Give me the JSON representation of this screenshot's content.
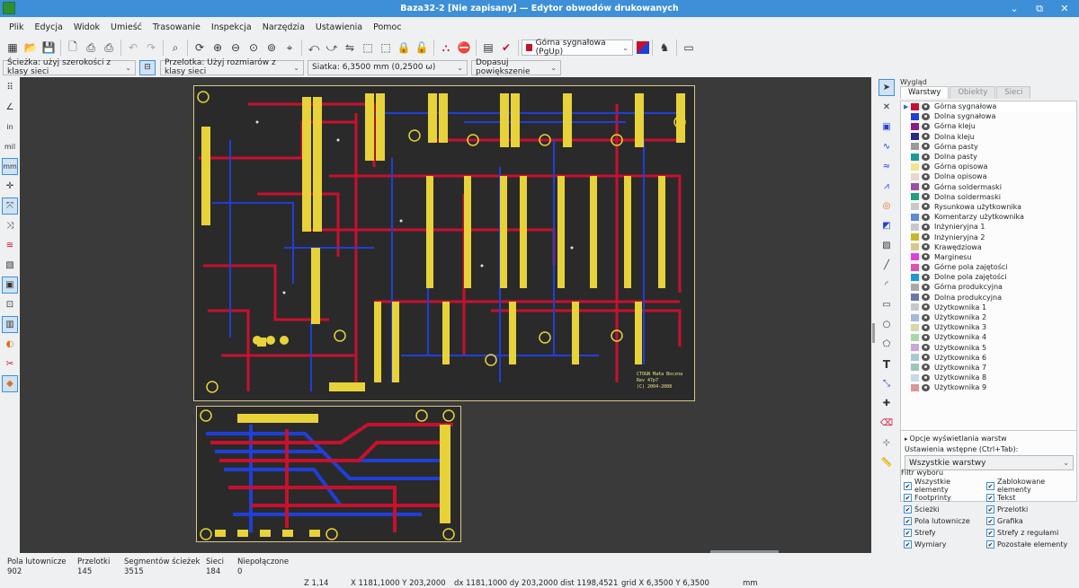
{
  "window": {
    "title": "Baza32-2 [Nie zapisany] — Edytor obwodów drukowanych",
    "controls": [
      "⌄",
      "⧉",
      "✕"
    ]
  },
  "menu": [
    "Plik",
    "Edycja",
    "Widok",
    "Umieść",
    "Trasowanie",
    "Inspekcja",
    "Narzędzia",
    "Ustawienia",
    "Pomoc"
  ],
  "toolbar": {
    "active_layer": "Górna sygnałowa (PgUp)",
    "active_layer_color": "#c8102e"
  },
  "options": {
    "track": "Ścieżka: użyj szerokości z klasy sieci",
    "via": "Przelotka: Użyj rozmiarów z klasy sieci",
    "grid": "Siatka: 6,3500 mm (0,2500 ω)",
    "zoom": "Dopasuj powiększenie"
  },
  "canvas": {
    "footer_text_1": "CTOGN Mała Boczna",
    "footer_text_2": "Rev 47p7",
    "footer_text_3": "(C) 2004-2008",
    "board_bg": "#2a2a2a",
    "top_copper": "#c8102e",
    "bottom_copper": "#1f3fd8",
    "pad_color": "#e8d23a"
  },
  "panel": {
    "title": "Wygląd",
    "tabs": [
      "Warstwy",
      "Obiekty",
      "Sieci"
    ],
    "layers": [
      {
        "name": "Górna sygnałowa",
        "color": "#c8102e"
      },
      {
        "name": "Dolna sygnałowa",
        "color": "#1f3fd8"
      },
      {
        "name": "Górna kleju",
        "color": "#8a1a8a"
      },
      {
        "name": "Dolna kleju",
        "color": "#2a2a8a"
      },
      {
        "name": "Górna pasty",
        "color": "#9a9a9a"
      },
      {
        "name": "Dolna pasty",
        "color": "#1a9a9a"
      },
      {
        "name": "Górna opisowa",
        "color": "#f0e68c"
      },
      {
        "name": "Dolna opisowa",
        "color": "#e8d8c8"
      },
      {
        "name": "Górna soldermaski",
        "color": "#a050a0"
      },
      {
        "name": "Dolna soldermaski",
        "color": "#20a080"
      },
      {
        "name": "Rysunkowa użytkownika",
        "color": "#c8c8c8"
      },
      {
        "name": "Komentarzy użytkownika",
        "color": "#5a8ad8"
      },
      {
        "name": "Inżynieryjna 1",
        "color": "#c8c8c8"
      },
      {
        "name": "Inżynieryjna 2",
        "color": "#c8b828"
      },
      {
        "name": "Krawędziowa",
        "color": "#d8c88a"
      },
      {
        "name": "Marginesu",
        "color": "#e040e0"
      },
      {
        "name": "Górne pola zajętości",
        "color": "#e050b0"
      },
      {
        "name": "Dolne pola zajętości",
        "color": "#1a9ad8"
      },
      {
        "name": "Górna produkcyjna",
        "color": "#a8a8a8"
      },
      {
        "name": "Dolna produkcyjna",
        "color": "#6878a8"
      },
      {
        "name": "Użytkownika 1",
        "color": "#c8c8c8"
      },
      {
        "name": "Użytkownika 2",
        "color": "#a8b8d8"
      },
      {
        "name": "Użytkownika 3",
        "color": "#d8d8a8"
      },
      {
        "name": "Użytkownika 4",
        "color": "#a8d8a8"
      },
      {
        "name": "Użytkownika 5",
        "color": "#c8a8d8"
      },
      {
        "name": "Użytkownika 6",
        "color": "#a8c8d8"
      },
      {
        "name": "Użytkownika 7",
        "color": "#98c8b8"
      },
      {
        "name": "Użytkownika 8",
        "color": "#c8d8e8"
      },
      {
        "name": "Użytkownika 9",
        "color": "#d89898"
      }
    ],
    "display_options": "Opcje wyświetlania warstw",
    "presets_label": "Ustawienia wstępne (Ctrl+Tab):",
    "preset_value": "Wszystkie warstwy",
    "filter_title": "Filtr wyboru",
    "filters": [
      "Wszystkie elementy",
      "Zablokowane elementy",
      "Footprinty",
      "Tekst",
      "Ścieżki",
      "Przelotki",
      "Pola lutownicze",
      "Grafika",
      "Strefy",
      "Strefy z regułami",
      "Wymiary",
      "Pozostałe elementy"
    ]
  },
  "status": {
    "pads_label": "Pola lutownicze",
    "pads_value": "902",
    "vias_label": "Przelotki",
    "vias_value": "145",
    "segments_label": "Segmentów ścieżek",
    "segments_value": "3515",
    "nets_label": "Sieci",
    "nets_value": "184",
    "unrouted_label": "Niepołączone",
    "unrouted_value": "0",
    "zoom": "Z 1,14",
    "xy": "X 1181,1000  Y 203,2000",
    "dxy": "dx 1181,1000  dy 203,2000  dist 1198,4521",
    "grid": "grid X 6,3500  Y 6,3500",
    "units": "mm"
  }
}
